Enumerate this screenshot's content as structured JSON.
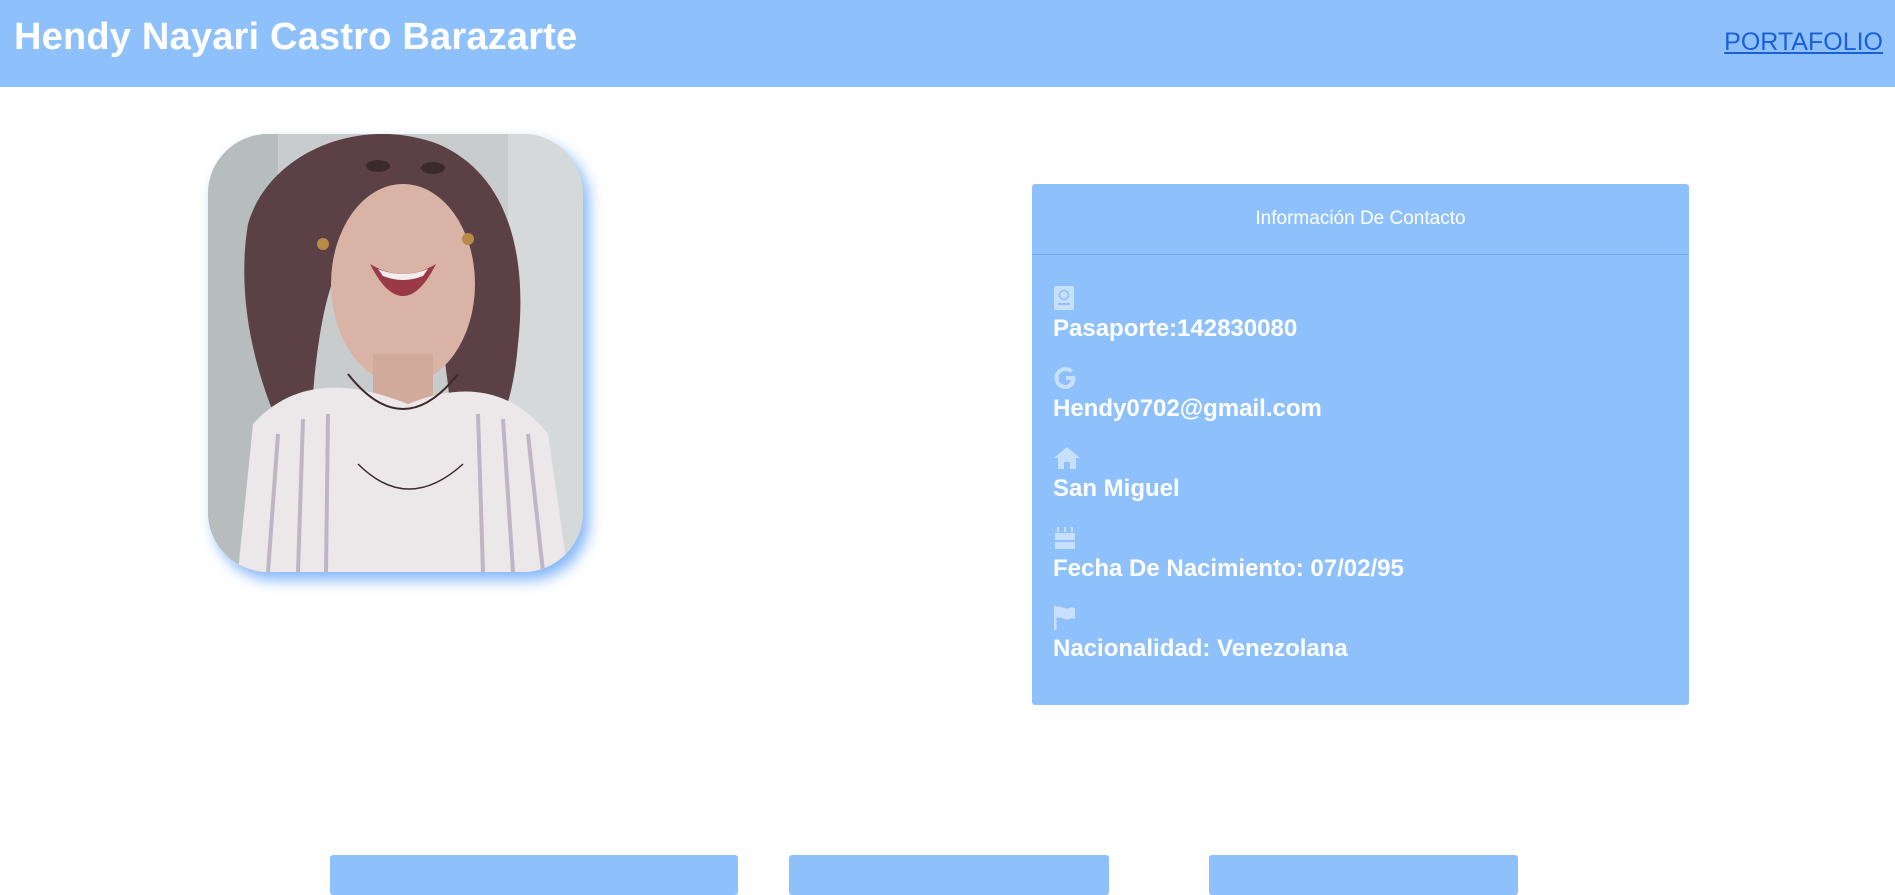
{
  "header": {
    "title": "Hendy Nayari Castro Barazarte",
    "nav_link": "PORTAFOLIO"
  },
  "contact": {
    "heading": "Información De Contacto",
    "items": [
      {
        "icon": "passport-icon",
        "text": "Pasaporte:142830080"
      },
      {
        "icon": "google-icon",
        "text": "Hendy0702@gmail.com"
      },
      {
        "icon": "home-icon",
        "text": "San Miguel"
      },
      {
        "icon": "birthday-cake-icon",
        "text": "Fecha De Nacimiento: 07/02/95"
      },
      {
        "icon": "flag-icon",
        "text": "Nacionalidad: Venezolana"
      }
    ]
  },
  "colors": {
    "accent": "#8ec1fb",
    "text_on_accent": "#ffffff",
    "link": "#1a5fd8",
    "icon": "#c9e0fd"
  }
}
